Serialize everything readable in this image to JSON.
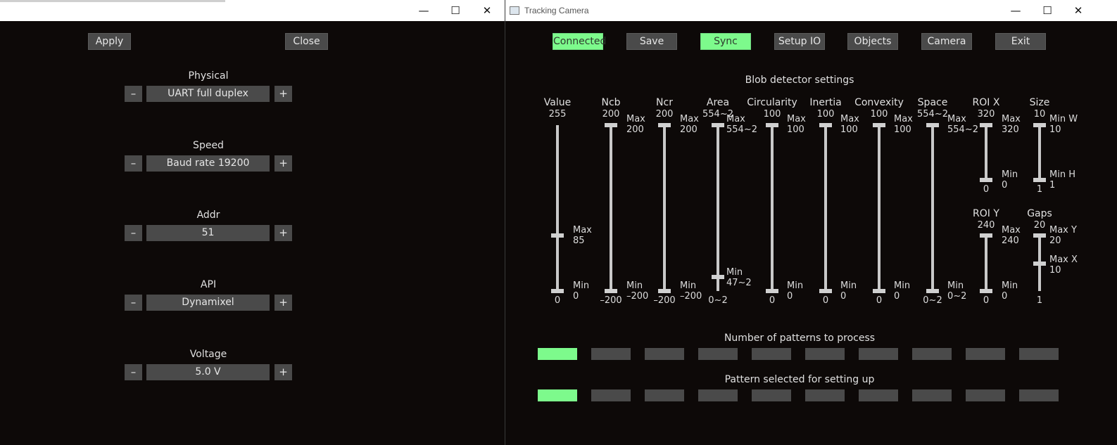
{
  "left": {
    "apply": "Apply",
    "close": "Close",
    "settings": [
      {
        "label": "Physical",
        "value": "UART full duplex"
      },
      {
        "label": "Speed",
        "value": "Baud rate 19200"
      },
      {
        "label": "Addr",
        "value": "51"
      },
      {
        "label": "API",
        "value": "Dynamixel"
      },
      {
        "label": "Voltage",
        "value": "5.0 V"
      }
    ],
    "minus": "–",
    "plus": "+"
  },
  "win_controls": {
    "minimize": "—",
    "maximize": "☐",
    "close": "✕"
  },
  "right": {
    "title": "Tracking Camera",
    "buttons": [
      {
        "label": "Connected",
        "active": true
      },
      {
        "label": "Save",
        "active": false
      },
      {
        "label": "Sync",
        "active": true
      },
      {
        "label": "Setup IO",
        "active": false
      },
      {
        "label": "Objects",
        "active": false
      },
      {
        "label": "Camera",
        "active": false
      },
      {
        "label": "Exit",
        "active": false
      }
    ],
    "blob_title": "Blob detector settings",
    "sliders": [
      {
        "name": "Value",
        "top": "255",
        "max_label": "Max",
        "max_val": "85",
        "min_label": "Min",
        "min_val": "0",
        "bottom": "0",
        "max_level": 0.333,
        "min_level": 0
      },
      {
        "name": "Ncb",
        "top": "200",
        "max_label": "Max",
        "max_val": "200",
        "min_label": "Min",
        "min_val": "–200",
        "bottom": "–200",
        "max_level": 1,
        "min_level": 0
      },
      {
        "name": "Ncr",
        "top": "200",
        "max_label": "Max",
        "max_val": "200",
        "min_label": "Min",
        "min_val": "–200",
        "bottom": "–200",
        "max_level": 1,
        "min_level": 0
      },
      {
        "name": "Area",
        "top": "554~2",
        "max_label": "Max",
        "max_val": "554~2",
        "min_label": "Min",
        "min_val": "47~2",
        "bottom": "0~2",
        "max_level": 1,
        "min_level": 0.085
      },
      {
        "name": "Circularity",
        "top": "100",
        "max_label": "Max",
        "max_val": "100",
        "min_label": "Min",
        "min_val": "0",
        "bottom": "0",
        "max_level": 1,
        "min_level": 0
      },
      {
        "name": "Inertia",
        "top": "100",
        "max_label": "Max",
        "max_val": "100",
        "min_label": "Min",
        "min_val": "0",
        "bottom": "0",
        "max_level": 1,
        "min_level": 0
      },
      {
        "name": "Convexity",
        "top": "100",
        "max_label": "Max",
        "max_val": "100",
        "min_label": "Min",
        "min_val": "0",
        "bottom": "0",
        "max_level": 1,
        "min_level": 0
      },
      {
        "name": "Space",
        "top": "554~2",
        "max_label": "Max",
        "max_val": "554~2",
        "min_label": "Min",
        "min_val": "0~2",
        "bottom": "0~2",
        "max_level": 1,
        "min_level": 0
      }
    ],
    "roi_x": {
      "name": "ROI X",
      "top": "320",
      "max_label": "Max",
      "max_val": "320",
      "min_label": "Min",
      "min_val": "0",
      "bottom": "0",
      "max_level": 1,
      "min_level": 0
    },
    "size": {
      "name": "Size",
      "top": "10",
      "max_label": "Min W",
      "max_val": "10",
      "min_label": "Min H",
      "min_val": "1",
      "bottom": "1",
      "max_level": 1,
      "min_level": 0
    },
    "roi_y": {
      "name": "ROI Y",
      "top": "240",
      "max_label": "Max",
      "max_val": "240",
      "min_label": "Min",
      "min_val": "0",
      "bottom": "0",
      "max_level": 1,
      "min_level": 0
    },
    "gaps": {
      "name": "Gaps",
      "top": "20",
      "max_label": "Max Y",
      "max_val": "20",
      "min_label": "Max X",
      "min_val": "10",
      "bottom": "1",
      "max_level": 1,
      "min_level": 0.5
    },
    "patterns_title": "Number of patterns to process",
    "patterns_count": 10,
    "patterns_active": 1,
    "selected_title": "Pattern selected for setting up",
    "selected_active": 1
  }
}
